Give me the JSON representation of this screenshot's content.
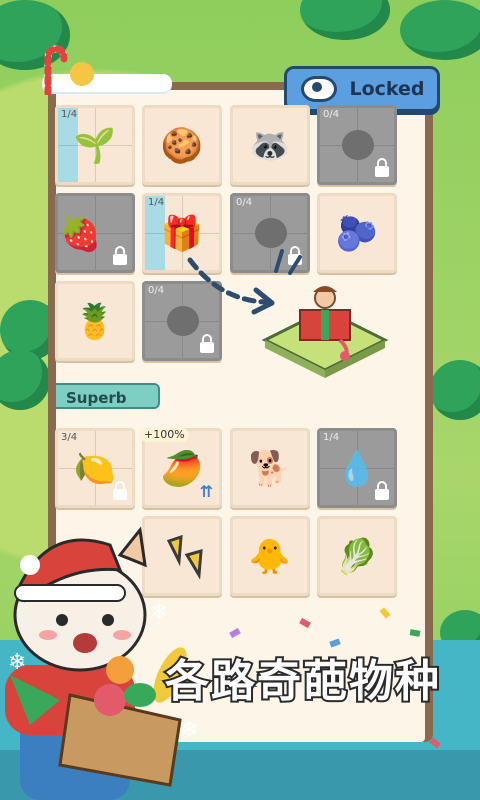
{
  "header": {
    "locked_label": "Locked"
  },
  "grid": {
    "row1": [
      {
        "count": "1/4",
        "item": "green-bean-creature",
        "emoji": "🌱",
        "locked": false,
        "gray": false
      },
      {
        "count": "",
        "item": "gingerbread-man",
        "emoji": "🍪",
        "locked": false,
        "gray": false
      },
      {
        "count": "",
        "item": "raccoon-creature",
        "emoji": "🦝",
        "locked": false,
        "gray": false
      },
      {
        "count": "0/4",
        "item": "unknown",
        "emoji": "",
        "locked": true,
        "gray": true
      }
    ],
    "row2": [
      {
        "count": "",
        "item": "strawberry-creature",
        "emoji": "🍓",
        "locked": true,
        "gray": true
      },
      {
        "count": "1/4",
        "item": "gift-box",
        "emoji": "🎁",
        "locked": false,
        "gray": false
      },
      {
        "count": "0/4",
        "item": "unknown",
        "emoji": "",
        "locked": true,
        "gray": true
      },
      {
        "count": "",
        "item": "black-seed-creature",
        "emoji": "🫐",
        "locked": false,
        "gray": false
      }
    ],
    "row3": [
      {
        "count": "",
        "item": "pineapple-creature",
        "emoji": "🍍",
        "locked": false,
        "gray": false
      },
      {
        "count": "0/4",
        "item": "unknown",
        "emoji": "",
        "locked": true,
        "gray": true
      }
    ],
    "section_label": "Superb",
    "row4": [
      {
        "count": "3/4",
        "item": "lemon-creature",
        "emoji": "🍋",
        "locked": true,
        "gray": false
      },
      {
        "count": "",
        "item": "mango-creature",
        "emoji": "🥭",
        "locked": false,
        "gray": false,
        "badge": "+100%"
      },
      {
        "count": "",
        "item": "shiba-dog",
        "emoji": "🐕",
        "locked": false,
        "gray": false
      },
      {
        "count": "1/4",
        "item": "blue-drop-creature",
        "emoji": "💧",
        "locked": true,
        "gray": true
      }
    ],
    "row5": [
      {
        "count": "",
        "item": "yellow-sprout",
        "emoji": "",
        "locked": false,
        "gray": false
      },
      {
        "count": "",
        "item": "duck-creature",
        "emoji": "🐥",
        "locked": false,
        "gray": false
      },
      {
        "count": "",
        "item": "green-onion",
        "emoji": "🥬",
        "locked": false,
        "gray": false
      }
    ]
  },
  "promo": {
    "title": "各路奇葩物种"
  },
  "colors": {
    "accent_blue": "#5c9fe0",
    "card_bg": "#f7e7d4",
    "locked_gray": "#9b9b9b"
  }
}
